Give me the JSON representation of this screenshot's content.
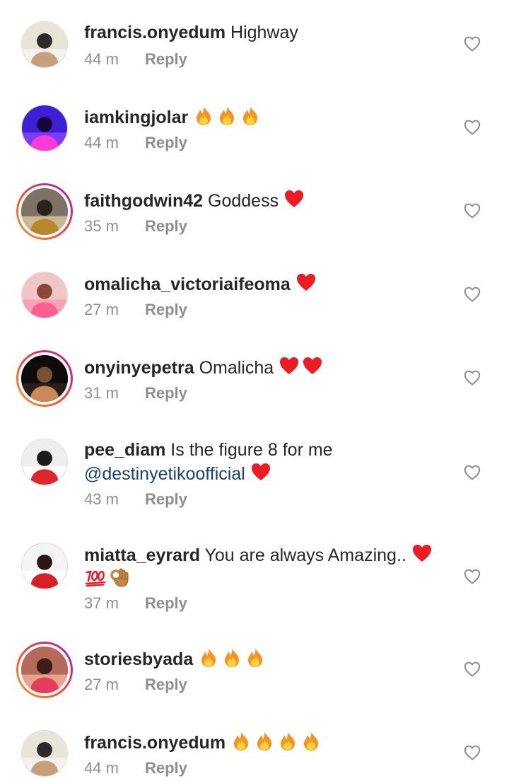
{
  "comments": [
    {
      "username": "francis.onyedum",
      "text": "Highway",
      "mention": "",
      "emojis": [],
      "emojis2": [],
      "time": "44 m",
      "reply": "Reply",
      "story_ring": false,
      "avatar_palette": [
        "#e9e4d8",
        "#f4f2ee",
        "#2d2a27",
        "#c7a07a"
      ]
    },
    {
      "username": "iamkingjolar",
      "text": "",
      "mention": "",
      "emojis": [
        "fire",
        "fire",
        "fire"
      ],
      "emojis2": [],
      "time": "44 m",
      "reply": "Reply",
      "story_ring": false,
      "avatar_palette": [
        "#3d1fd6",
        "#7b3cff",
        "#14063a",
        "#ff3bd4"
      ]
    },
    {
      "username": "faithgodwin42",
      "text": "Goddess",
      "mention": "",
      "emojis": [
        "red-heart"
      ],
      "emojis2": [],
      "time": "35 m",
      "reply": "Reply",
      "story_ring": true,
      "avatar_palette": [
        "#7d7264",
        "#c8b994",
        "#2a211b",
        "#b8872a"
      ]
    },
    {
      "username": "omalicha_victoriaifeoma",
      "text": "",
      "mention": "",
      "emojis": [
        "red-heart"
      ],
      "emojis2": [],
      "time": "27 m",
      "reply": "Reply",
      "story_ring": false,
      "avatar_palette": [
        "#f0c6c8",
        "#f7a2b5",
        "#8a4a3a",
        "#ff5f8f"
      ]
    },
    {
      "username": "onyinyepetra",
      "text": "Omalicha",
      "mention": "",
      "emojis": [
        "red-heart",
        "red-heart"
      ],
      "emojis2": [],
      "time": "31 m",
      "reply": "Reply",
      "story_ring": true,
      "avatar_palette": [
        "#0d0b0c",
        "#2a1e1a",
        "#7a5033",
        "#c98a58"
      ]
    },
    {
      "username": "pee_diam",
      "text": "Is the figure 8 for me",
      "mention": "@destinyetikoofficial",
      "emojis": [],
      "emojis2": [
        "red-heart"
      ],
      "time": "43 m",
      "reply": "Reply",
      "story_ring": false,
      "avatar_palette": [
        "#eeeeee",
        "#ffffff",
        "#1a1a1a",
        "#e0252d"
      ]
    },
    {
      "username": "miatta_eyrard",
      "text": "You are always Amazing..",
      "mention": "",
      "emojis": [
        "red-heart"
      ],
      "emojis2": [
        "hundred-points",
        "ok-hand"
      ],
      "time": "37 m",
      "reply": "Reply",
      "story_ring": false,
      "avatar_palette": [
        "#f4f4f4",
        "#ffffff",
        "#2a1812",
        "#d91f26"
      ]
    },
    {
      "username": "storiesbyada",
      "text": "",
      "mention": "",
      "emojis": [
        "fire",
        "fire",
        "fire"
      ],
      "emojis2": [],
      "time": "27 m",
      "reply": "Reply",
      "story_ring": true,
      "avatar_palette": [
        "#b56a5a",
        "#e6a38e",
        "#3a1e17",
        "#e33d5b"
      ]
    },
    {
      "username": "francis.onyedum",
      "text": "",
      "mention": "",
      "emojis": [
        "fire",
        "fire",
        "fire",
        "fire"
      ],
      "emojis2": [],
      "time": "44 m",
      "reply": "Reply",
      "story_ring": false,
      "avatar_palette": [
        "#e9e4d8",
        "#f4f2ee",
        "#2d2a27",
        "#c7a07a"
      ]
    }
  ],
  "colors": {
    "text": "#262626",
    "meta": "#8e8e8e",
    "mention": "#1c3f7a",
    "heart": "#ed1c24",
    "fire_outer": "#f7931e",
    "fire_inner": "#ffd23f"
  },
  "icons": {
    "like": "heart-outline-icon",
    "fire": "fire-emoji-icon",
    "red-heart": "red-heart-emoji-icon",
    "hundred-points": "hundred-points-emoji-icon",
    "ok-hand": "ok-hand-emoji-icon"
  }
}
